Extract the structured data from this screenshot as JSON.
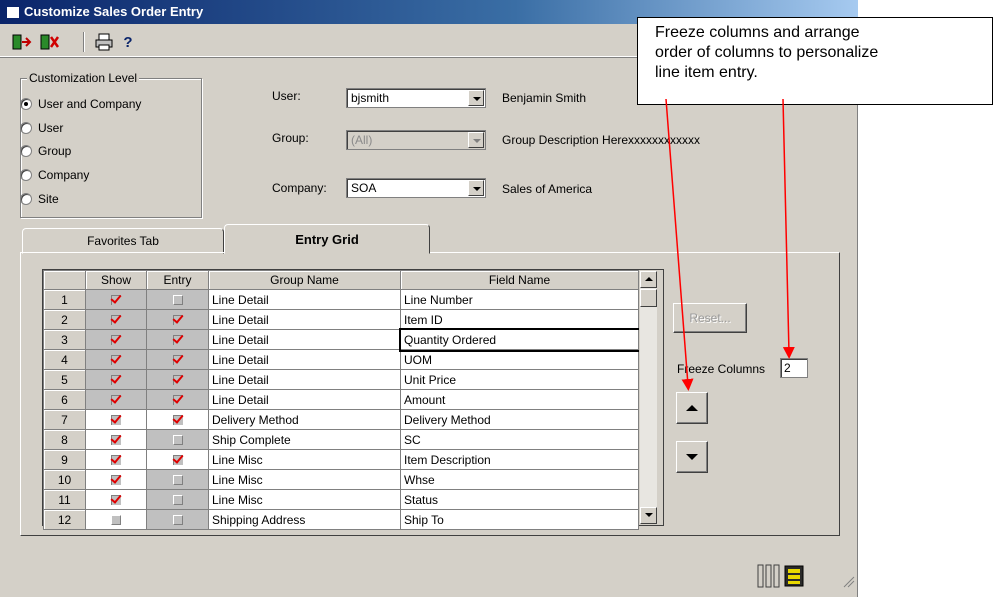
{
  "window": {
    "title": "Customize Sales Order Entry",
    "toolbar": {
      "icons": [
        "save-exit-icon",
        "exit-icon",
        "print-icon",
        "help-icon"
      ],
      "help_label": "?"
    }
  },
  "customization": {
    "title": "Customization Level",
    "options": [
      {
        "label": "User and Company",
        "selected": true
      },
      {
        "label": "User",
        "selected": false
      },
      {
        "label": "Group",
        "selected": false
      },
      {
        "label": "Company",
        "selected": false
      },
      {
        "label": "Site",
        "selected": false
      }
    ]
  },
  "fields": {
    "user": {
      "label": "User:",
      "value": "bjsmith",
      "description": "Benjamin Smith"
    },
    "group": {
      "label": "Group:",
      "value": "(All)",
      "description": "Group Description Herexxxxxxxxxxxx",
      "disabled": true
    },
    "company": {
      "label": "Company:",
      "value": "SOA",
      "description": "Sales of America"
    }
  },
  "tabs": [
    {
      "label": "Favorites Tab",
      "active": false
    },
    {
      "label": "Entry Grid",
      "active": true
    }
  ],
  "grid": {
    "columns": [
      "Show",
      "Entry",
      "Group Name",
      "Field Name"
    ],
    "rows": [
      {
        "n": "1",
        "show": true,
        "entry": false,
        "group": "Line Detail",
        "field": "Line Number",
        "locked": true
      },
      {
        "n": "2",
        "show": true,
        "entry": true,
        "group": "Line Detail",
        "field": "Item ID",
        "locked": true
      },
      {
        "n": "3",
        "show": true,
        "entry": true,
        "group": "Line Detail",
        "field": "Quantity Ordered",
        "locked": true
      },
      {
        "n": "4",
        "show": true,
        "entry": true,
        "group": "Line Detail",
        "field": "UOM",
        "locked": true
      },
      {
        "n": "5",
        "show": true,
        "entry": true,
        "group": "Line Detail",
        "field": "Unit Price",
        "locked": true
      },
      {
        "n": "6",
        "show": true,
        "entry": true,
        "group": "Line Detail",
        "field": "Amount",
        "locked": true
      },
      {
        "n": "7",
        "show": true,
        "entry": true,
        "group": "Delivery Method",
        "field": "Delivery Method",
        "locked": false
      },
      {
        "n": "8",
        "show": true,
        "entry": false,
        "group": "Ship Complete",
        "field": "SC",
        "locked": false
      },
      {
        "n": "9",
        "show": true,
        "entry": true,
        "group": "Line Misc",
        "field": "Item Description",
        "locked": false
      },
      {
        "n": "10",
        "show": true,
        "entry": false,
        "group": "Line Misc",
        "field": "Whse",
        "locked": false
      },
      {
        "n": "11",
        "show": true,
        "entry": false,
        "group": "Line Misc",
        "field": "Status",
        "locked": false
      },
      {
        "n": "12",
        "show": false,
        "entry": false,
        "group": "Shipping Address",
        "field": "Ship To",
        "locked": false
      }
    ]
  },
  "actions": {
    "reset_label": "Reset...",
    "freeze_label": "Freeze Columns",
    "freeze_value": "2"
  },
  "callout": {
    "lines": [
      "Freeze columns and arrange",
      "order of columns to personalize",
      "line item entry."
    ]
  },
  "colors": {
    "window_face": "#d4d0c8",
    "title_bar": "#0a246a",
    "check_mark": "#e00000",
    "annotation_arrow": "#ff0000"
  }
}
